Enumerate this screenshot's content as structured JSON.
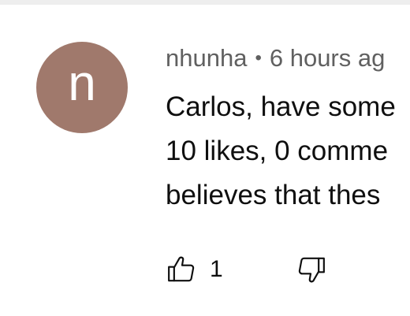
{
  "comment": {
    "avatar": {
      "letter": "n",
      "color": "#a0796c"
    },
    "author": "nhunha",
    "separator": "•",
    "time": "6 hours ag",
    "text_lines": [
      "Carlos, have some",
      "10 likes, 0 comme",
      "believes that thes"
    ],
    "like_count": "1",
    "icons": {
      "like": "thumbs-up-icon",
      "dislike": "thumbs-down-icon"
    }
  }
}
